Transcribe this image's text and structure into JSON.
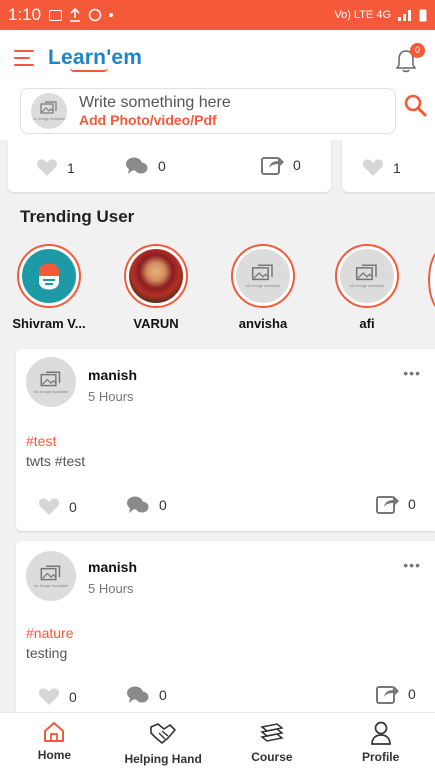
{
  "status_bar": {
    "time": "1:10",
    "right_text": "Vo) LTE 4G"
  },
  "app": {
    "logo_main": "Learn",
    "logo_suffix": "'em",
    "notification_count": "0"
  },
  "compose": {
    "placeholder": "Write something here",
    "add_label": "Add Photo/video/Pdf",
    "no_image_caption": "No Image Available"
  },
  "strip": {
    "card1": {
      "likes": "1",
      "comments": "0",
      "shares": "0"
    },
    "card2": {
      "likes": "1"
    }
  },
  "trending": {
    "title": "Trending User",
    "users": [
      {
        "name": "Shivram V..."
      },
      {
        "name": "VARUN"
      },
      {
        "name": "anvisha"
      },
      {
        "name": "afi"
      }
    ]
  },
  "posts": [
    {
      "author": "manish",
      "time": "5 Hours",
      "tag": "#test",
      "body": "twts #test",
      "likes": "0",
      "comments": "0",
      "shares": "0",
      "more": "•••"
    },
    {
      "author": "manish",
      "time": "5 Hours",
      "tag": "#nature",
      "body": "testing",
      "likes": "0",
      "comments": "0",
      "shares": "0",
      "more": "•••"
    }
  ],
  "bottom_nav": [
    {
      "label": "Home"
    },
    {
      "label": "Helping Hand"
    },
    {
      "label": "Course"
    },
    {
      "label": "Profile"
    }
  ],
  "colors": {
    "accent": "#f45a3a",
    "brand_blue": "#1f86c6"
  }
}
